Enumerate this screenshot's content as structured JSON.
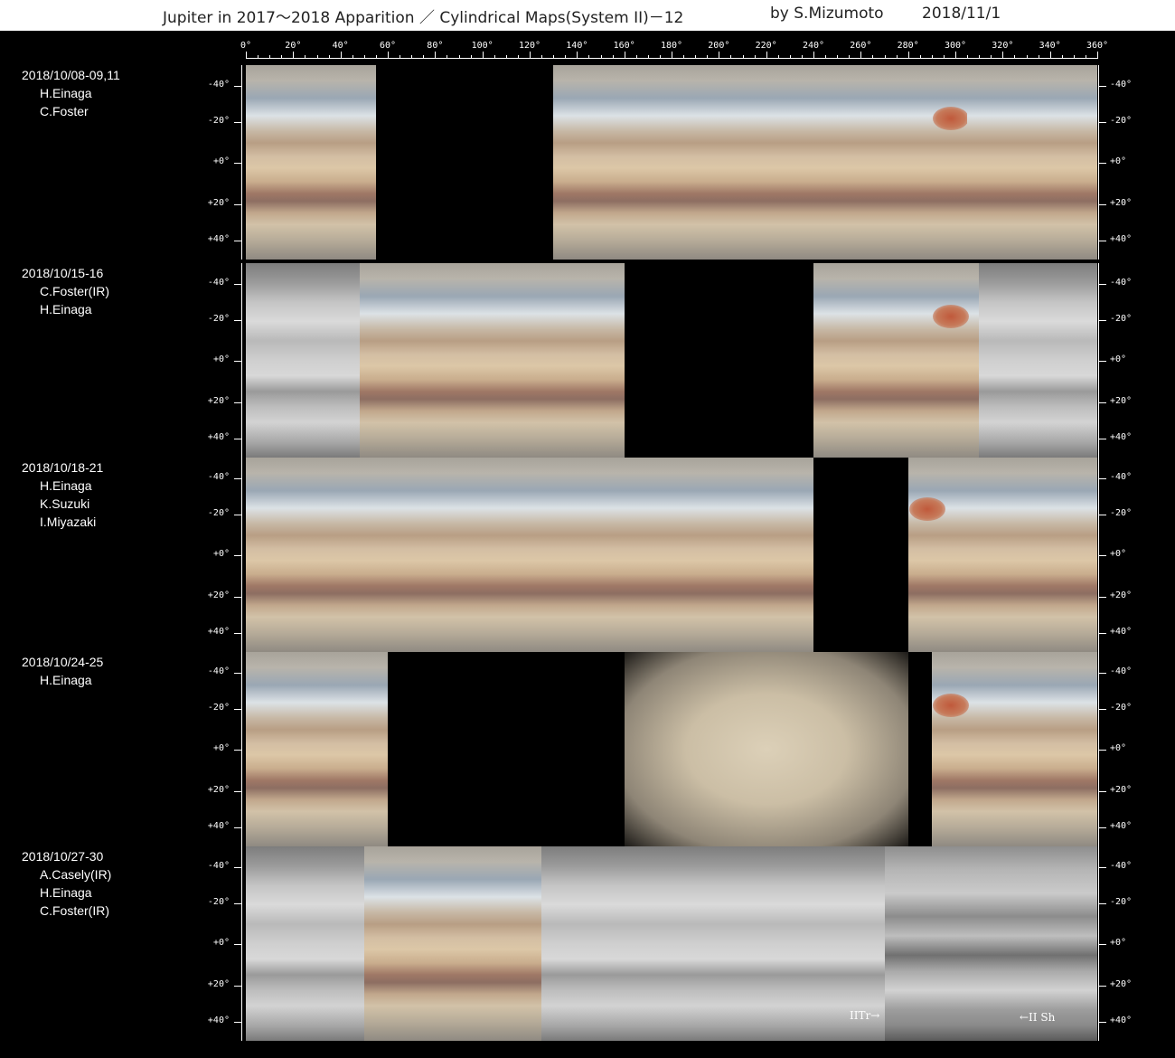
{
  "header": {
    "title": "Jupiter in 2017～2018 Apparition ／ Cylindrical Maps(System II)－12",
    "author": "by S.Mizumoto",
    "date": "2018/11/1"
  },
  "longitude_labels": [
    "0°",
    "20°",
    "40°",
    "60°",
    "80°",
    "100°",
    "120°",
    "140°",
    "160°",
    "180°",
    "200°",
    "220°",
    "240°",
    "260°",
    "280°",
    "300°",
    "320°",
    "340°",
    "360°"
  ],
  "latitude_labels": [
    "-40°",
    "-20°",
    "+0°",
    "+20°",
    "+40°"
  ],
  "panels": [
    {
      "date": "2018/10/08-09,11",
      "observers": [
        "H.Einaga",
        "C.Foster"
      ],
      "segments": [
        {
          "from": 0,
          "to": 55,
          "style": "color"
        },
        {
          "from": 55,
          "to": 130,
          "style": "black"
        },
        {
          "from": 130,
          "to": 190,
          "style": "color"
        },
        {
          "from": 190,
          "to": 305,
          "style": "color",
          "grs": 298
        },
        {
          "from": 305,
          "to": 360,
          "style": "color"
        }
      ]
    },
    {
      "date": "2018/10/15-16",
      "observers": [
        "C.Foster(IR)",
        "H.Einaga"
      ],
      "segments": [
        {
          "from": 0,
          "to": 48,
          "style": "ir"
        },
        {
          "from": 48,
          "to": 160,
          "style": "color"
        },
        {
          "from": 160,
          "to": 240,
          "style": "black"
        },
        {
          "from": 240,
          "to": 310,
          "style": "color",
          "grs": 298
        },
        {
          "from": 310,
          "to": 360,
          "style": "ir"
        }
      ]
    },
    {
      "date": "2018/10/18-21",
      "observers": [
        "H.Einaga",
        "K.Suzuki",
        "I.Miyazaki"
      ],
      "segments": [
        {
          "from": 0,
          "to": 72,
          "style": "color"
        },
        {
          "from": 72,
          "to": 134,
          "style": "color"
        },
        {
          "from": 134,
          "to": 184,
          "style": "color"
        },
        {
          "from": 184,
          "to": 240,
          "style": "color"
        },
        {
          "from": 240,
          "to": 280,
          "style": "black"
        },
        {
          "from": 280,
          "to": 360,
          "style": "color",
          "grs": 288
        }
      ]
    },
    {
      "date": "2018/10/24-25",
      "observers": [
        "H.Einaga"
      ],
      "segments": [
        {
          "from": 0,
          "to": 60,
          "style": "color"
        },
        {
          "from": 60,
          "to": 160,
          "style": "black"
        },
        {
          "from": 160,
          "to": 280,
          "style": "blur"
        },
        {
          "from": 280,
          "to": 290,
          "style": "black"
        },
        {
          "from": 290,
          "to": 360,
          "style": "color",
          "grs": 298
        }
      ]
    },
    {
      "date": "2018/10/27-30",
      "observers": [
        "A.Casely(IR)",
        "H.Einaga",
        "C.Foster(IR)"
      ],
      "segments": [
        {
          "from": 0,
          "to": 50,
          "style": "ir"
        },
        {
          "from": 50,
          "to": 125,
          "style": "color"
        },
        {
          "from": 125,
          "to": 205,
          "style": "ir"
        },
        {
          "from": 205,
          "to": 270,
          "style": "ir"
        },
        {
          "from": 270,
          "to": 360,
          "style": "ir-dark"
        }
      ]
    }
  ],
  "annotations": {
    "iitr": "IITr→",
    "iish": "←II Sh"
  }
}
